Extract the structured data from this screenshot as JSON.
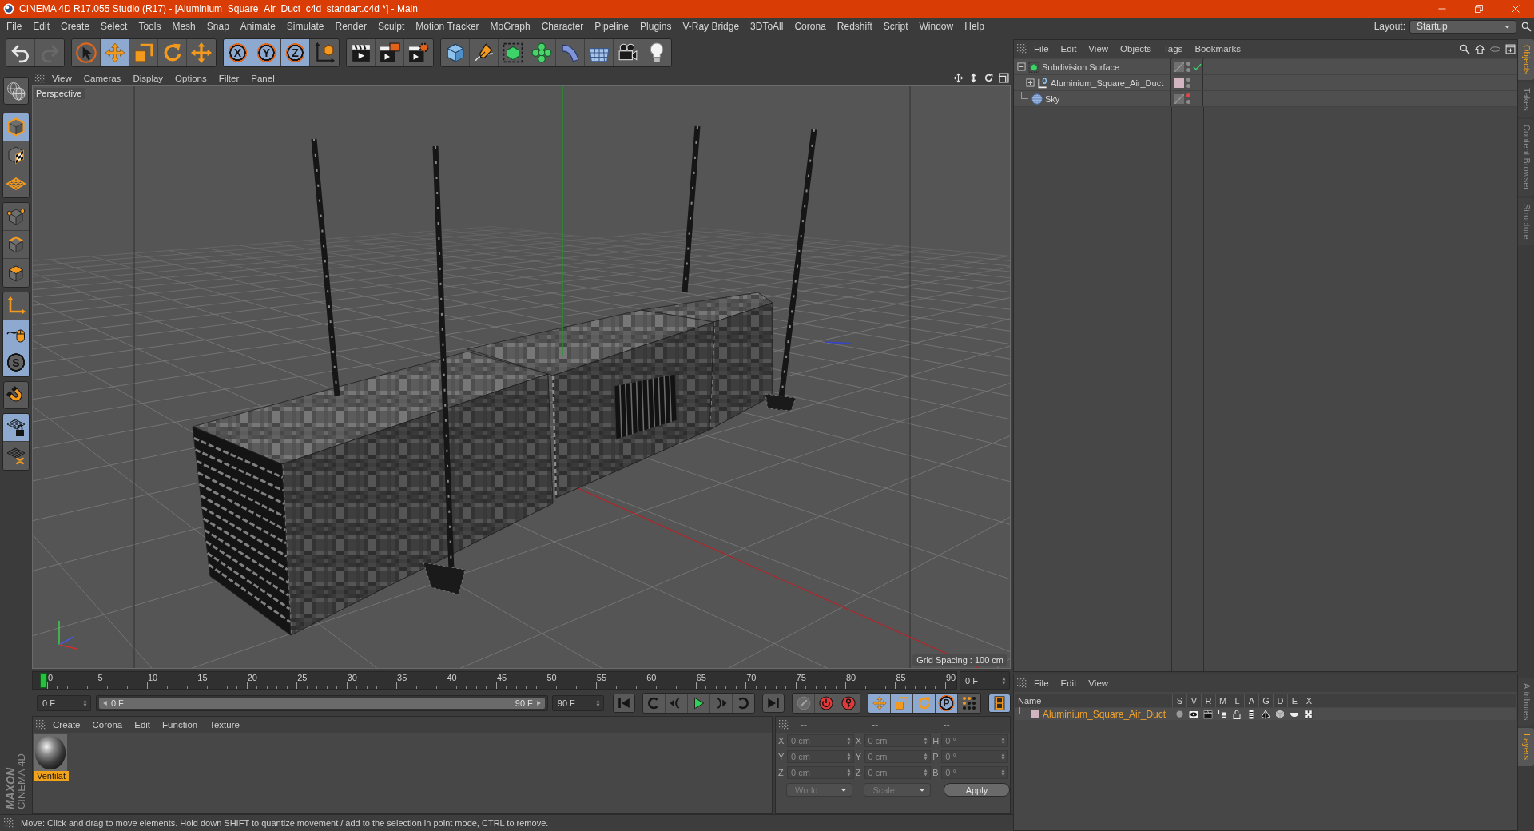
{
  "window": {
    "title": "CINEMA 4D R17.055 Studio (R17) - [Aluminium_Square_Air_Duct_c4d_standart.c4d *] - Main"
  },
  "menu_bar": [
    "File",
    "Edit",
    "Create",
    "Select",
    "Tools",
    "Mesh",
    "Snap",
    "Animate",
    "Simulate",
    "Render",
    "Sculpt",
    "Motion Tracker",
    "MoGraph",
    "Character",
    "Pipeline",
    "Plugins",
    "V-Ray Bridge",
    "3DToAll",
    "Corona",
    "Redshift",
    "Script",
    "Window",
    "Help"
  ],
  "layout": {
    "label": "Layout:",
    "value": "Startup"
  },
  "toolbar": [
    {
      "buttons": [
        {
          "selected": false,
          "disabled": false
        },
        {
          "selected": false,
          "disabled": true
        }
      ]
    },
    {
      "buttons": [
        {
          "selected": false
        },
        {
          "selected": true
        },
        {
          "selected": false
        },
        {
          "selected": false
        },
        {
          "selected": false
        }
      ]
    },
    {
      "buttons": [
        {
          "label": "X",
          "selected": true
        },
        {
          "label": "Y",
          "selected": true
        },
        {
          "label": "Z",
          "selected": true
        },
        {
          "selected": false
        }
      ]
    },
    {
      "buttons": [
        {
          "selected": false
        },
        {
          "selected": false
        },
        {
          "selected": false
        }
      ]
    },
    {
      "buttons": [
        {
          "selected": false
        },
        {
          "selected": false
        },
        {
          "selected": false
        },
        {
          "selected": false
        },
        {
          "selected": false
        },
        {
          "selected": false
        },
        {
          "selected": false
        },
        {
          "selected": false
        }
      ]
    }
  ],
  "mode_toolbar": [
    {
      "buttons": [
        {
          "selected": false
        }
      ]
    },
    {
      "buttons": [
        {
          "selected": true
        },
        {
          "selected": false
        },
        {
          "selected": false
        }
      ]
    },
    {
      "buttons": [
        {
          "selected": false
        },
        {
          "selected": false
        },
        {
          "selected": false
        }
      ]
    },
    {
      "buttons": [
        {
          "selected": false
        },
        {
          "selected": true
        },
        {
          "label": "S",
          "selected": true
        }
      ]
    },
    {
      "buttons": [
        {
          "selected": false
        }
      ]
    },
    {
      "buttons": [
        {
          "selected": true
        },
        {
          "selected": false
        }
      ]
    }
  ],
  "viewport": {
    "menu": [
      "View",
      "Cameras",
      "Display",
      "Options",
      "Filter",
      "Panel"
    ],
    "camera": "Perspective",
    "grid_spacing": "Grid Spacing : 100 cm"
  },
  "timeline": {
    "frames": [
      "0",
      "5",
      "10",
      "15",
      "20",
      "25",
      "30",
      "35",
      "40",
      "45",
      "50",
      "55",
      "60",
      "65",
      "70",
      "75",
      "80",
      "85",
      "90"
    ],
    "level": 0,
    "current": "0 F",
    "start": "0 F",
    "range": {
      "start": "0 F",
      "end": "90 F",
      "level": 1
    },
    "end": "90 F",
    "groups": [
      {
        "buttons": [
          {
            "selected": false
          }
        ]
      },
      {
        "buttons": [
          {
            "selected": false
          },
          {
            "selected": false
          },
          {
            "selected": false
          },
          {
            "selected": false
          },
          {
            "selected": false
          }
        ]
      },
      {
        "buttons": [
          {
            "selected": false
          }
        ]
      },
      {
        "buttons": [
          {
            "selected": false
          },
          {
            "selected": false
          },
          {
            "selected": false
          }
        ]
      },
      {
        "buttons": [
          {
            "selected": true
          },
          {
            "selected": true
          },
          {
            "selected": true
          },
          {
            "label": "P",
            "selected": true
          },
          {
            "selected": false
          }
        ]
      },
      {
        "buttons": [
          {
            "selected": true
          }
        ]
      }
    ]
  },
  "material_manager": {
    "menu": [
      "Create",
      "Corona",
      "Edit",
      "Function",
      "Texture"
    ],
    "materials": [
      {
        "name": "Ventilat",
        "selected": true
      }
    ]
  },
  "coordinates": {
    "headers": [
      "--",
      "--",
      "--"
    ],
    "rows": [
      [
        {
          "label": "X",
          "value": "0 cm"
        },
        {
          "label": "X",
          "value": "0 cm"
        },
        {
          "label": "H",
          "value": "0 °"
        }
      ],
      [
        {
          "label": "Y",
          "value": "0 cm"
        },
        {
          "label": "Y",
          "value": "0 cm"
        },
        {
          "label": "P",
          "value": "0 °"
        }
      ],
      [
        {
          "label": "Z",
          "value": "0 cm"
        },
        {
          "label": "Z",
          "value": "0 cm"
        },
        {
          "label": "B",
          "value": "0 °"
        }
      ]
    ],
    "dropdowns": [
      "World",
      "Scale"
    ],
    "apply": "Apply"
  },
  "object_manager": {
    "menu": [
      "File",
      "Edit",
      "View",
      "Objects",
      "Tags",
      "Bookmarks"
    ],
    "objects": [
      {
        "kind": "subdivision",
        "name": "Subdivision Surface",
        "selected": false,
        "expanded": true,
        "editor_visible": true,
        "render_visible": true,
        "enabled": true,
        "children": [
          {
            "kind": "null",
            "name": "Aluminium_Square_Air_Duct",
            "selected": false,
            "expanded": false,
            "color": "#d3b4c1",
            "editor_visible": true,
            "render_visible": true
          }
        ]
      },
      {
        "kind": "sky",
        "name": "Sky",
        "selected": false,
        "editor_visible": false,
        "render_visible": true
      }
    ]
  },
  "object_tabs": [
    {
      "label": "Objects",
      "selected": true
    },
    {
      "label": "Takes",
      "selected": false
    },
    {
      "label": "Content Browser",
      "selected": false
    },
    {
      "label": "Structure",
      "selected": false
    }
  ],
  "layers_manager": {
    "menu": [
      "File",
      "Edit",
      "View"
    ],
    "columns": [
      "Name",
      "S",
      "V",
      "R",
      "M",
      "L",
      "A",
      "G",
      "D",
      "E",
      "X"
    ],
    "layers": [
      {
        "name": "Aluminium_Square_Air_Duct",
        "color": "#d3b4c1",
        "selected": false,
        "solo": false
      }
    ]
  },
  "attribute_tabs": [
    {
      "label": "Attributes",
      "selected": false
    },
    {
      "label": "Layers",
      "selected": true
    }
  ],
  "brand": [
    "MAXON",
    "CINEMA 4D"
  ],
  "status_bar": "Move: Click and drag to move elements. Hold down SHIFT to quantize movement / add to the selection in point mode, CTRL to remove."
}
